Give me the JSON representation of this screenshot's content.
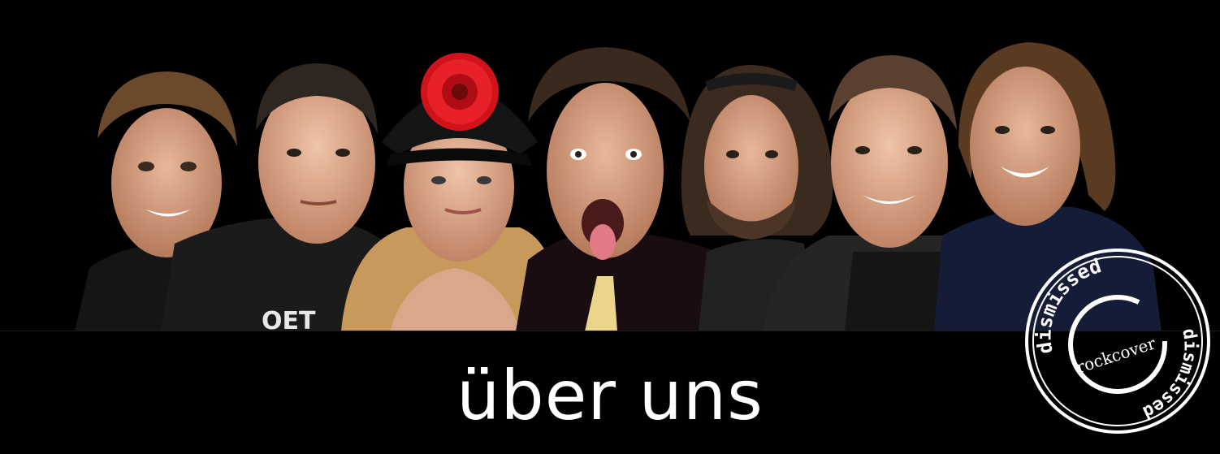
{
  "header": {
    "title": "über uns"
  },
  "photo": {
    "people_count": 7,
    "background_color": "#000000"
  },
  "logo": {
    "text_top": "dismissed",
    "text_middle": "rockcover",
    "text_bottom": "dismissed",
    "color": "#ffffff"
  }
}
